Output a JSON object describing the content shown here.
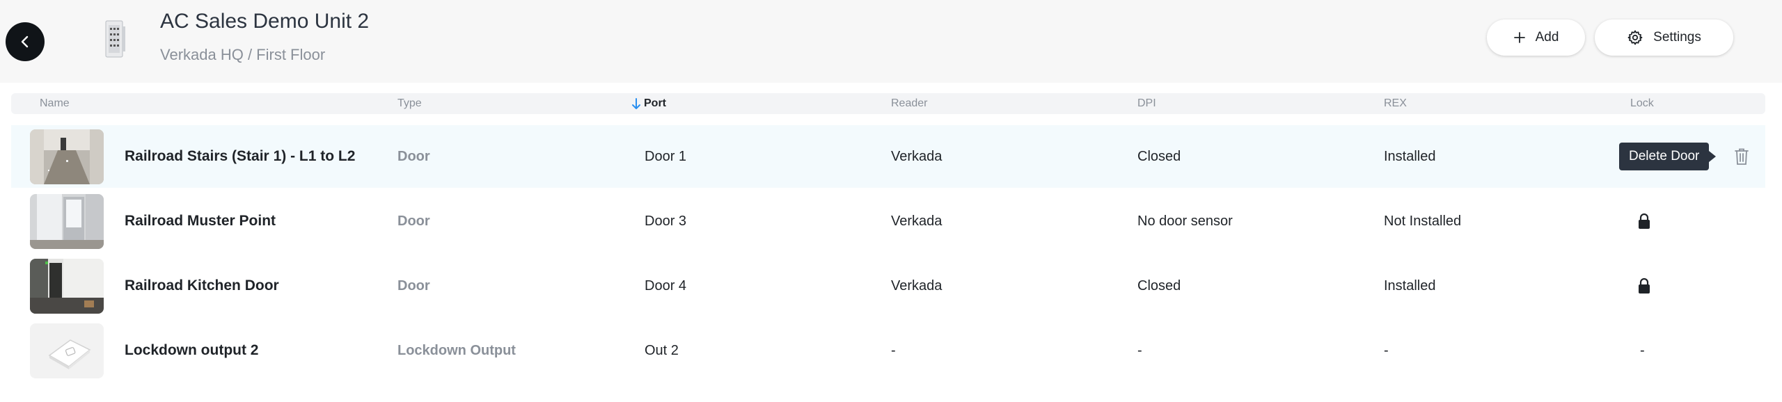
{
  "header": {
    "title": "AC Sales Demo Unit 2",
    "breadcrumb": "Verkada HQ / First Floor",
    "add_label": "Add",
    "settings_label": "Settings"
  },
  "table": {
    "columns": [
      "Name",
      "Type",
      "Port",
      "Reader",
      "DPI",
      "REX",
      "Lock"
    ],
    "sorted_column": "Port",
    "rows": [
      {
        "name": "Railroad Stairs (Stair 1) - L1 to L2",
        "type": "Door",
        "port": "Door 1",
        "reader": "Verkada",
        "dpi": "Closed",
        "rex": "Installed",
        "lock": ""
      },
      {
        "name": "Railroad Muster Point",
        "type": "Door",
        "port": "Door 3",
        "reader": "Verkada",
        "dpi": "No door sensor",
        "rex": "Not Installed",
        "lock": "lock-icon"
      },
      {
        "name": "Railroad Kitchen Door",
        "type": "Door",
        "port": "Door 4",
        "reader": "Verkada",
        "dpi": "Closed",
        "rex": "Installed",
        "lock": "lock-icon"
      },
      {
        "name": "Lockdown output 2",
        "type": "Lockdown Output",
        "port": "Out 2",
        "reader": "-",
        "dpi": "-",
        "rex": "-",
        "lock": "-"
      }
    ]
  },
  "tooltip": {
    "text": "Delete Door"
  },
  "colors": {
    "accent": "#2a8ff0",
    "dark": "#101418",
    "hover_row": "#f3fafd"
  }
}
